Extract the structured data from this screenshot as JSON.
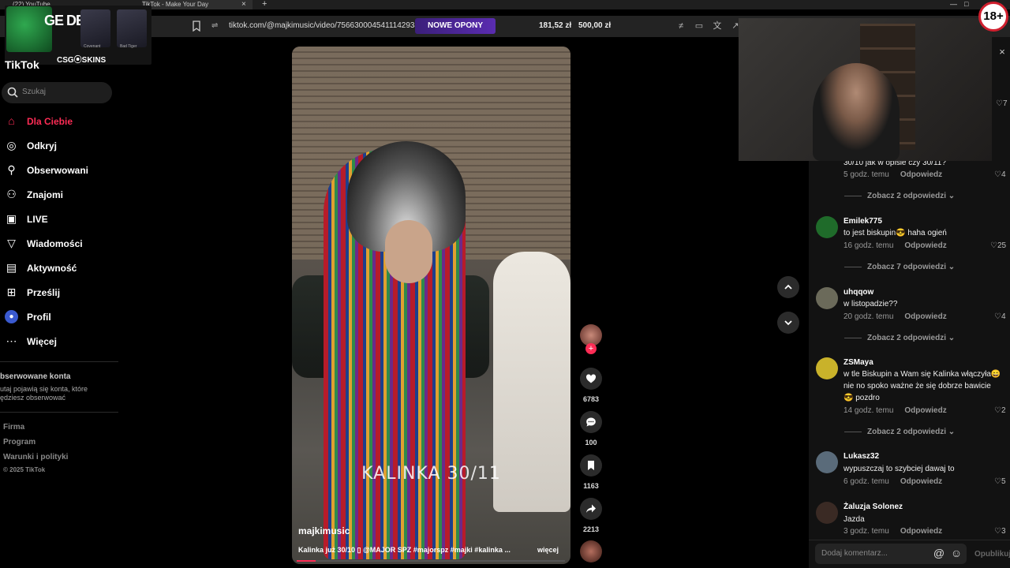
{
  "browser": {
    "tabs": [
      {
        "title": "(22) YouTube"
      },
      {
        "title": "TikTok - Make Your Day"
      }
    ],
    "new_tab_glyph": "+",
    "tab_close_glyph": "×",
    "url": "tiktok.com/@majkimusic/video/7566300045411142934",
    "promo_label": "NOWE OPONY",
    "price_1": "181,52 zł",
    "price_2": "500,00 zł",
    "bookmark_icon": "bookmark-icon",
    "window_controls": [
      "—",
      "□"
    ]
  },
  "overlay": {
    "title": "GE DE",
    "brand": "CSG⦿SKINS",
    "card_labels": [
      "Covenant",
      "Bad Tiger"
    ]
  },
  "sidebar": {
    "logo": "TikTok",
    "search_placeholder": "Szukaj",
    "items": [
      {
        "label": "Dla Ciebie",
        "icon": "home-icon",
        "active": true
      },
      {
        "label": "Odkryj",
        "icon": "compass-icon"
      },
      {
        "label": "Obserwowani",
        "icon": "user-follow-icon"
      },
      {
        "label": "Znajomi",
        "icon": "friends-icon"
      },
      {
        "label": "LIVE",
        "icon": "live-tv-icon"
      },
      {
        "label": "Wiadomości",
        "icon": "send-icon"
      },
      {
        "label": "Aktywność",
        "icon": "activity-icon"
      },
      {
        "label": "Prześlij",
        "icon": "upload-icon"
      },
      {
        "label": "Profil",
        "icon": "profile-icon"
      },
      {
        "label": "Więcej",
        "icon": "more-icon"
      }
    ],
    "followed_title": "bserwowane konta",
    "followed_desc": "utaj pojawią się konta, które ędziesz obserwować",
    "footer": [
      "Firma",
      "Program",
      "Warunki i polityki"
    ],
    "copyright": "© 2025 TikTok"
  },
  "video": {
    "caption_overlay": "KALINKA 30/11",
    "author": "majkimusic",
    "description": "Kalinka już 30/10 ▯ @MAJOR SPZ #majorspz #majki #kalinka ...",
    "more_label": "więcej",
    "progress": 0.07,
    "actions": {
      "likes": "6783",
      "comments": "100",
      "saves": "1163",
      "shares": "2213"
    }
  },
  "comments_panel": {
    "close_glyph": "×",
    "age_badge": "18+",
    "top_partial": {
      "text": "30/10 jak w opisie czy 30/11?",
      "time": "5 godz. temu",
      "reply": "Odpowiedz",
      "likes": "4",
      "more": "Zobacz 2 odpowiedzi"
    },
    "top_partial_like": "7",
    "comments": [
      {
        "user": "Emilek775",
        "text": "to jest biskupin😎 haha ogień",
        "time": "16 godz. temu",
        "reply": "Odpowiedz",
        "likes": "25",
        "more": "Zobacz 7 odpowiedzi",
        "avatar_color": "#1f6b2a"
      },
      {
        "user": "uhqqow",
        "text": "w listopadzie??",
        "time": "20 godz. temu",
        "reply": "Odpowiedz",
        "likes": "4",
        "more": "Zobacz 2 odpowiedzi",
        "avatar_color": "#6b6a5a"
      },
      {
        "user": "ZSMaya",
        "text": "w tle Biskupin a Wam się Kalinka włączyła😄 nie no spoko ważne że się dobrze bawicie 😎 pozdro",
        "time": "14 godz. temu",
        "reply": "Odpowiedz",
        "likes": "2",
        "more": "Zobacz 2 odpowiedzi",
        "avatar_color": "#c9b22a"
      },
      {
        "user": "Lukasz32",
        "text": "wypuszczaj to szybciej dawaj to",
        "time": "6 godz. temu",
        "reply": "Odpowiedz",
        "likes": "5",
        "avatar_color": "#5a6b7a"
      },
      {
        "user": "Żaluzja Solonez",
        "text": "Jazda",
        "time": "3 godz. temu",
        "reply": "Odpowiedz",
        "likes": "3",
        "avatar_color": "#3a2a24"
      }
    ],
    "input_placeholder": "Dodaj komentarz...",
    "at_glyph": "@",
    "emoji_glyph": "☺",
    "publish_label": "Opublikuj"
  },
  "nav": {
    "up_icon": "chevron-up-icon",
    "down_icon": "chevron-down-icon"
  }
}
